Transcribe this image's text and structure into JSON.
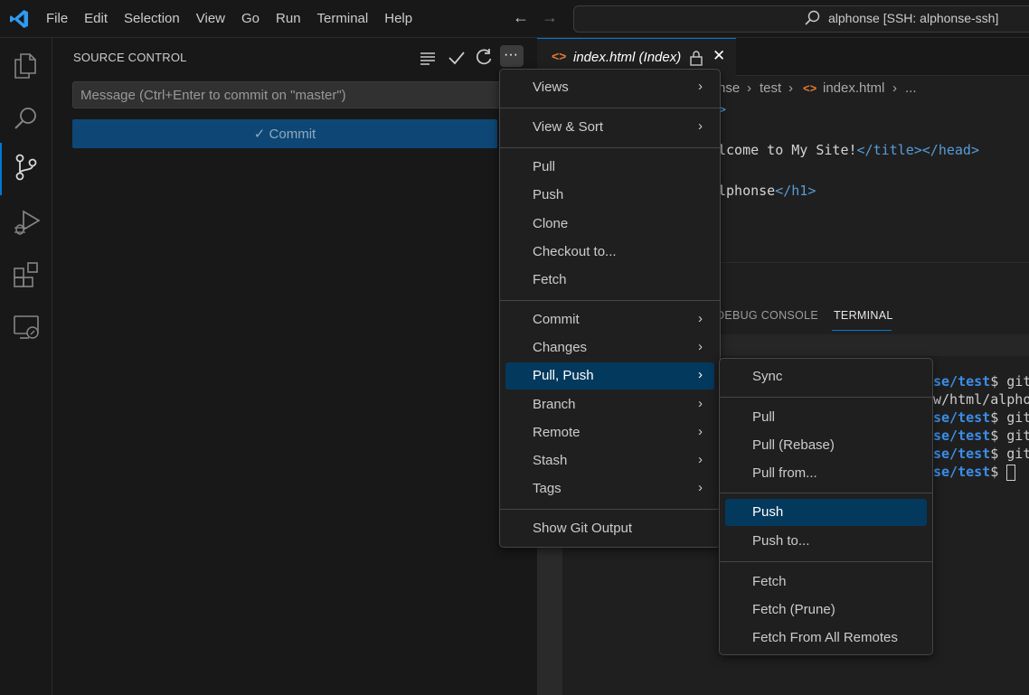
{
  "titlebar": {
    "menu": [
      "File",
      "Edit",
      "Selection",
      "View",
      "Go",
      "Run",
      "Terminal",
      "Help"
    ],
    "back_icon": "arrow-left-icon",
    "forward_icon": "arrow-right-icon",
    "search_text": "alphonse [SSH: alphonse-ssh]"
  },
  "activity_bar": {
    "items": [
      "explorer",
      "search",
      "source-control",
      "run-and-debug",
      "extensions",
      "remote-explorer"
    ],
    "active": "source-control"
  },
  "sidebar": {
    "title": "SOURCE CONTROL",
    "message_placeholder": "Message (Ctrl+Enter to commit on \"master\")",
    "commit_label": "✓ Commit",
    "more_label": "···"
  },
  "editor": {
    "tab_name": "index.html (Index)",
    "tab_close": "✕",
    "breadcrumb": [
      "nse",
      "test",
      "index.html",
      "..."
    ],
    "code_lines": [
      {
        "pre": ">",
        "mid": "",
        "post": ""
      },
      {
        "pre": "lcome to My Site!",
        "mid": "</title></head>",
        "post": ""
      },
      {
        "pre": "lphonse",
        "mid": "</h1>",
        "post": ""
      }
    ]
  },
  "panel": {
    "tabs": [
      "DEBUG CONSOLE",
      "TERMINAL"
    ],
    "active_tab": "TERMINAL",
    "terminal_lines": [
      {
        "path": "se/test",
        "rest": "$ git"
      },
      {
        "path": "",
        "rest": "w/html/alpho"
      },
      {
        "path": "se/test",
        "rest": "$ git"
      },
      {
        "path": "se/test",
        "rest": "$ git"
      },
      {
        "path": "se/test",
        "rest": "$ git"
      },
      {
        "path": "se/test",
        "rest": "$ "
      }
    ]
  },
  "menu_main": {
    "groups": [
      [
        {
          "label": "Views",
          "submenu": true
        }
      ],
      [
        {
          "label": "View & Sort",
          "submenu": true
        }
      ],
      [
        {
          "label": "Pull"
        },
        {
          "label": "Push"
        },
        {
          "label": "Clone"
        },
        {
          "label": "Checkout to..."
        },
        {
          "label": "Fetch"
        }
      ],
      [
        {
          "label": "Commit",
          "submenu": true
        },
        {
          "label": "Changes",
          "submenu": true
        },
        {
          "label": "Pull, Push",
          "submenu": true,
          "highlighted": true
        },
        {
          "label": "Branch",
          "submenu": true
        },
        {
          "label": "Remote",
          "submenu": true
        },
        {
          "label": "Stash",
          "submenu": true
        },
        {
          "label": "Tags",
          "submenu": true
        }
      ],
      [
        {
          "label": "Show Git Output"
        }
      ]
    ]
  },
  "menu_sub": {
    "groups": [
      [
        {
          "label": "Sync"
        }
      ],
      [
        {
          "label": "Pull"
        },
        {
          "label": "Pull (Rebase)"
        },
        {
          "label": "Pull from..."
        }
      ],
      [
        {
          "label": "Push",
          "highlighted": true
        },
        {
          "label": "Push to..."
        }
      ],
      [
        {
          "label": "Fetch"
        },
        {
          "label": "Fetch (Prune)"
        },
        {
          "label": "Fetch From All Remotes"
        }
      ]
    ]
  },
  "colors": {
    "accent": "#0078d4",
    "menu_highlight": "#04395e",
    "commit_button": "#0e4775",
    "html_tag": "#569cd6",
    "terminal_path": "#3b8eea"
  }
}
